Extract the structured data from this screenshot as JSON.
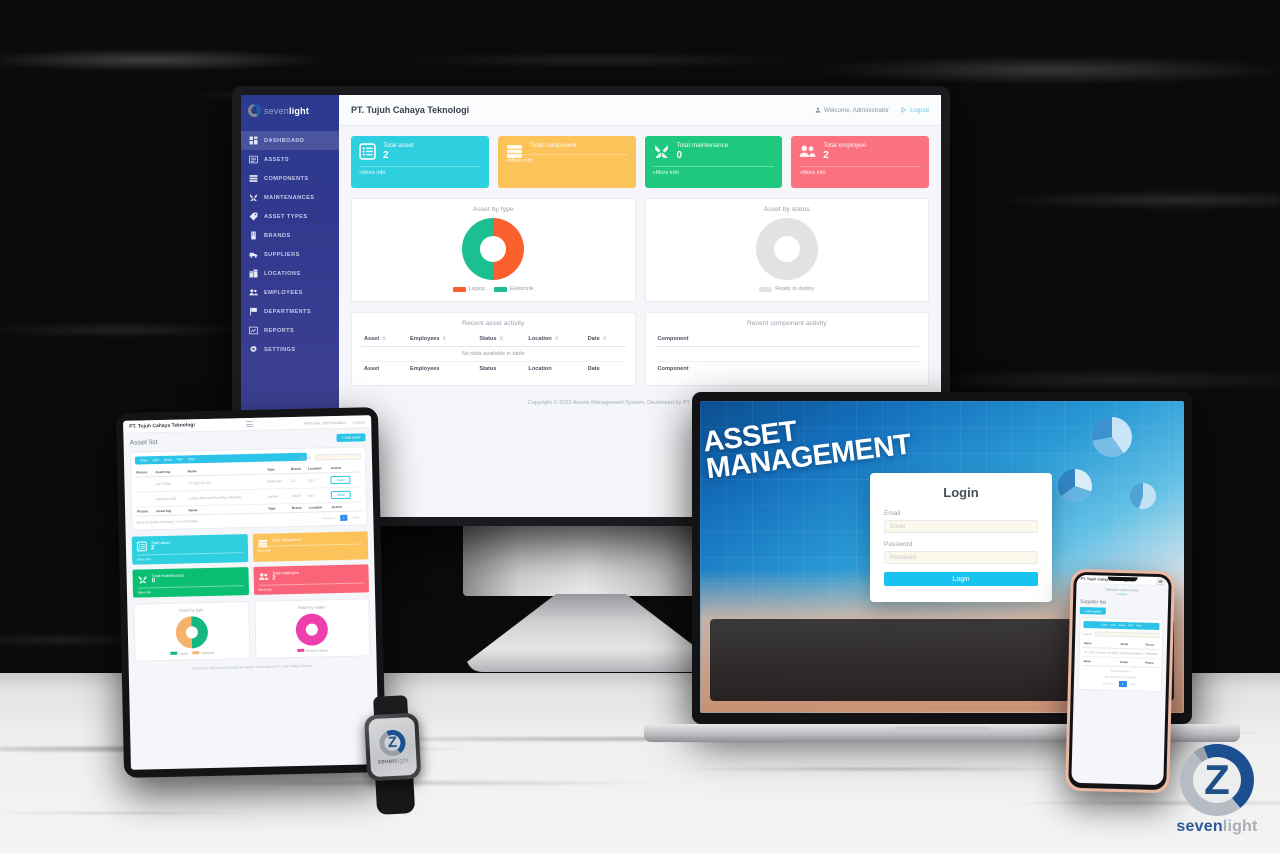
{
  "brand": {
    "name_dark": "seven",
    "name_light": "light",
    "full": "sevenlight",
    "logo_letter": "Z"
  },
  "desktop": {
    "topbar": {
      "title": "PT. Tujuh Cahaya Teknologi",
      "welcome": "Welcome, Administrator",
      "logout": "Logout"
    },
    "sidebar": {
      "items": [
        {
          "label": "DASHBOARD",
          "icon": "grid-icon",
          "active": true
        },
        {
          "label": "ASSETS",
          "icon": "list-box-icon",
          "active": false
        },
        {
          "label": "COMPONENTS",
          "icon": "layers-icon",
          "active": false
        },
        {
          "label": "MAINTENANCES",
          "icon": "tools-icon",
          "active": false
        },
        {
          "label": "ASSET TYPES",
          "icon": "tag-icon",
          "active": false
        },
        {
          "label": "BRANDS",
          "icon": "building-icon",
          "active": false
        },
        {
          "label": "SUPPLIERS",
          "icon": "truck-icon",
          "active": false
        },
        {
          "label": "LOCATIONS",
          "icon": "map-pin-icon",
          "active": false
        },
        {
          "label": "EMPLOYEES",
          "icon": "people-icon",
          "active": false
        },
        {
          "label": "DEPARTMENTS",
          "icon": "flag-icon",
          "active": false
        },
        {
          "label": "REPORTS",
          "icon": "chart-icon",
          "active": false
        },
        {
          "label": "SETTINGS",
          "icon": "gear-icon",
          "active": false
        }
      ]
    },
    "stat_cards": [
      {
        "label": "Total asset",
        "value": "2",
        "more": "More info",
        "color": "#2ed0e0",
        "icon": "list-icon"
      },
      {
        "label": "Total component",
        "value": "",
        "more": "More info",
        "color": "#fcc35a",
        "icon": "server-icon"
      },
      {
        "label": "Total maintenance",
        "value": "0",
        "more": "More info",
        "color": "#1ec97f",
        "icon": "tools-icon"
      },
      {
        "label": "Total employee",
        "value": "2",
        "more": "More info",
        "color": "#fa7280",
        "icon": "people-icon"
      }
    ],
    "panels": {
      "asset_by_type": "Asset by type",
      "asset_by_status": "Asset by status",
      "recent_asset_activity": "Recent asset activity",
      "recent_component_activity": "Recent component activity"
    },
    "asset_table": {
      "headers": [
        "Asset",
        "Employees",
        "Status",
        "Location",
        "Date"
      ],
      "empty_text": "No data available in table",
      "footers": [
        "Asset",
        "Employees",
        "Status",
        "Location",
        "Date"
      ]
    },
    "component_table": {
      "headers": [
        "Component"
      ],
      "footers": [
        "Component"
      ]
    },
    "copyright": "Copyright © 2022 Assets Management System. Developed by PT. Tujuh Cahaya Teknologi"
  },
  "chart_data": [
    {
      "type": "pie",
      "title": "Asset by type",
      "labels": [
        "Laptop",
        "Elektronik"
      ],
      "values": [
        1,
        1
      ],
      "colors": [
        "#fb5f2d",
        "#1bbf92"
      ],
      "legend": "bottom",
      "device": "desktop"
    },
    {
      "type": "pie",
      "title": "Asset by status",
      "labels": [
        "Ready to deploy"
      ],
      "values": [
        1
      ],
      "colors": [
        "#e2e2e4"
      ],
      "legend": "bottom",
      "device": "desktop"
    },
    {
      "type": "pie",
      "title": "Asset by type",
      "labels": [
        "Laptop",
        "Elektronik"
      ],
      "values": [
        1,
        1
      ],
      "colors": [
        "#15b97f",
        "#f6b26b"
      ],
      "legend": "bottom",
      "device": "tablet"
    },
    {
      "type": "pie",
      "title": "Asset by status",
      "labels": [
        "Ready to deploy"
      ],
      "values": [
        1
      ],
      "colors": [
        "#ef3fad"
      ],
      "legend": "bottom",
      "device": "tablet"
    }
  ],
  "tablet": {
    "topbar": {
      "title": "PT. Tujuh Cahaya Teknologi",
      "welcome": "Welcome, Administrator",
      "logout": "Logout"
    },
    "page_title": "Asset list",
    "add_button": "Add asset",
    "toolbar_buttons": [
      "Copy",
      "CSV",
      "Excel",
      "PDF",
      "Print",
      "Column visibility"
    ],
    "search_label": "Search:",
    "search_value": "",
    "table": {
      "headers": [
        "Picture",
        "Asset tag",
        "Name",
        "Type",
        "Brand",
        "Location",
        "Action"
      ],
      "rows": [
        {
          "asset_tag": "ast777010",
          "name": "TV LCD 32 inch",
          "type": "Elektronik",
          "brand": "LG",
          "location": "Gd 1",
          "action": "Detail"
        },
        {
          "asset_tag": "laptop-pc-002",
          "name": "Lenovo New IdeaPad Flip 14ADA05",
          "type": "Laptop",
          "brand": "ASUS",
          "location": "Gd 1",
          "action": "Detail"
        }
      ],
      "footers": [
        "Picture",
        "Asset tag",
        "Name",
        "Type",
        "Brand",
        "Location",
        "Action"
      ]
    },
    "show_label": "Show",
    "show_value": "10",
    "entries_label": "entries",
    "info": "Showing 1 to 2 of 2 entries",
    "pagination": {
      "previous": "Previous",
      "pages": [
        "1"
      ],
      "next": "Next",
      "current": "1"
    },
    "stat_cards": [
      {
        "label": "Total asset",
        "value": "2",
        "more": "More info",
        "color": "#2ed0e0",
        "icon": "list-icon"
      },
      {
        "label": "Total component",
        "value": "",
        "more": "More info",
        "color": "#fcc35a",
        "icon": "server-icon"
      },
      {
        "label": "Total maintenance",
        "value": "0",
        "more": "More info",
        "color": "#0bbf72",
        "icon": "tools-icon"
      },
      {
        "label": "Total employee",
        "value": "2",
        "more": "More info",
        "color": "#fa6478",
        "icon": "people-icon"
      }
    ],
    "copyright": "Copyright © 2022 Assets Management System. Developed by PT. Tujuh Cahaya Teknologi"
  },
  "laptop": {
    "banner_line1": "ASSET",
    "banner_line2": "MANAGEMENT",
    "login": {
      "title": "Login",
      "email_label": "Email",
      "email_placeholder": "Email",
      "email_value": "",
      "password_label": "Password",
      "password_placeholder": "Password",
      "password_value": "",
      "button": "Login",
      "button_color": "#19c3ef"
    }
  },
  "phone": {
    "topbar": {
      "title": "PT. Tujuh Cahaya Teknologi",
      "welcome": "Welcome, Administrator",
      "logout": "Logout"
    },
    "page_title": "Supplier list",
    "add_button": "Add supplier",
    "toolbar_buttons": [
      "Copy",
      "CSV",
      "Excel",
      "PDF",
      "Print",
      "Column visibility"
    ],
    "search_label": "Search:",
    "search_value": "",
    "table": {
      "headers": [
        "Name",
        "Email",
        "Phone"
      ],
      "rows": [
        {
          "name": "PT. Tujuh Cahaya Teknologi",
          "email": "info@sevenlight.id",
          "phone": "08983588"
        }
      ],
      "footers": [
        "Name",
        "Email",
        "Phone"
      ]
    },
    "show_label": "Show",
    "show_value": "10",
    "entries_label": "entries",
    "info": "Showing 1 to 1 of 1 entries",
    "pagination": {
      "previous": "Previous",
      "pages": [
        "1"
      ],
      "next": "Next",
      "current": "1"
    }
  },
  "watch": {
    "brand_dark": "seven",
    "brand_light": "light"
  },
  "corner_logo": {
    "brand_dark": "seven",
    "brand_light": "light"
  }
}
